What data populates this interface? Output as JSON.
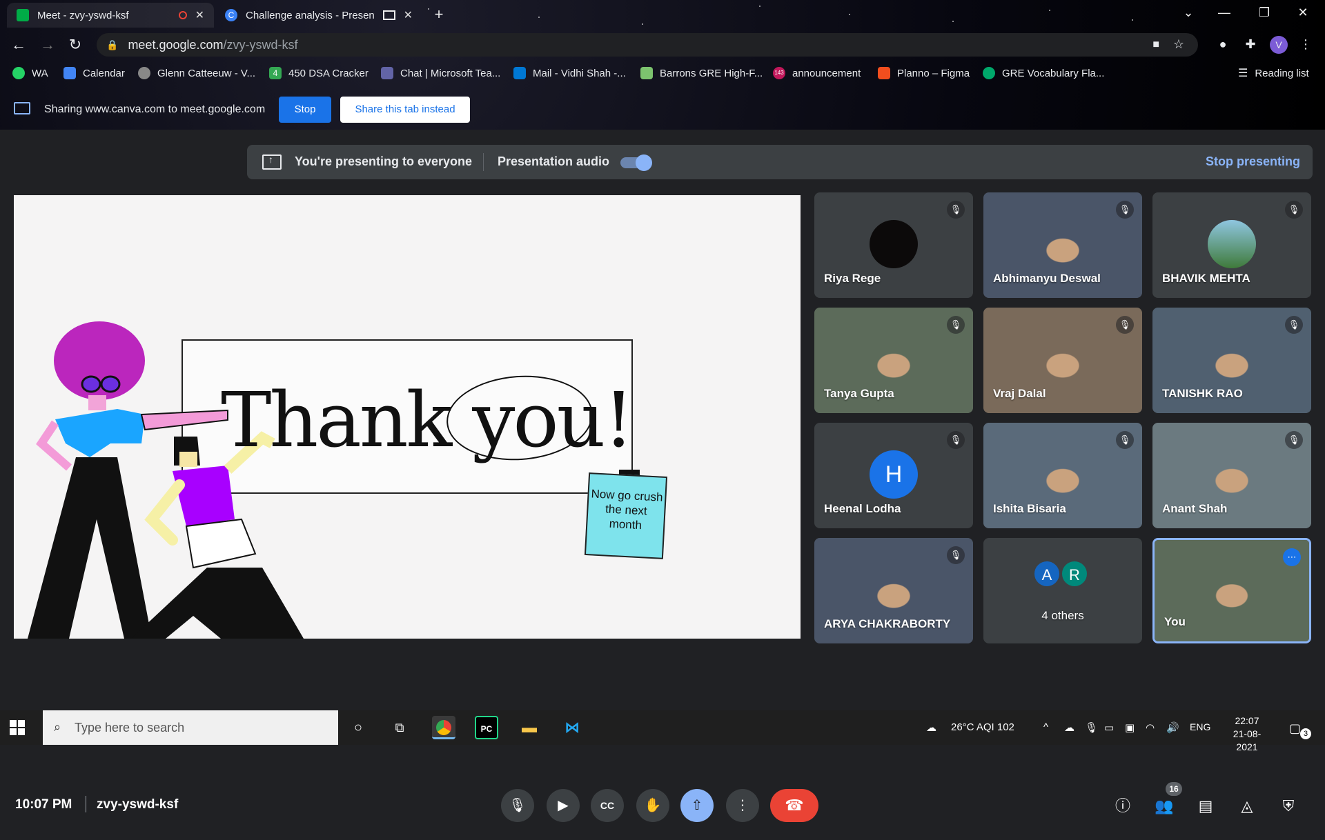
{
  "browser": {
    "tabs": [
      {
        "title": "Meet - zvy-yswd-ksf",
        "active": true,
        "recording": true
      },
      {
        "title": "Challenge analysis - Presenta",
        "active": false
      }
    ],
    "url_host": "meet.google.com",
    "url_path": "/zvy-yswd-ksf",
    "bookmarks": [
      "WA",
      "Calendar",
      "Glenn Catteeuw - V...",
      "450 DSA Cracker",
      "Chat | Microsoft Tea...",
      "Mail - Vidhi Shah -...",
      "Barrons GRE High-F...",
      "announcement",
      "Planno – Figma",
      "GRE Vocabulary Fla..."
    ],
    "reading_list": "Reading list",
    "bookmark_badges": {
      "dsa": "4",
      "announcement": "143"
    },
    "profile_initial": "V"
  },
  "share_bar": {
    "text": "Sharing www.canva.com to meet.google.com",
    "stop": "Stop",
    "share_tab": "Share this tab instead"
  },
  "present_bar": {
    "status": "You're presenting to everyone",
    "audio_label": "Presentation audio",
    "audio_on": true,
    "stop_label": "Stop presenting"
  },
  "slide": {
    "heading": "Thank you!",
    "note": "Now go crush the next month"
  },
  "participants": [
    {
      "name": "Riya Rege",
      "muted": true,
      "avatar": "dark-circle"
    },
    {
      "name": "Abhimanyu Deswal",
      "muted": true,
      "avatar": "video"
    },
    {
      "name": "BHAVIK MEHTA",
      "muted": true,
      "avatar": "photo"
    },
    {
      "name": "Tanya Gupta",
      "muted": true,
      "avatar": "video"
    },
    {
      "name": "Vraj Dalal",
      "muted": true,
      "avatar": "video"
    },
    {
      "name": "TANISHK RAO",
      "muted": true,
      "avatar": "video"
    },
    {
      "name": "Heenal Lodha",
      "muted": true,
      "avatar": "letter",
      "initial": "H"
    },
    {
      "name": "Ishita Bisaria",
      "muted": true,
      "avatar": "video"
    },
    {
      "name": "Anant Shah",
      "muted": true,
      "avatar": "video"
    },
    {
      "name": "ARYA CHAKRABORTY",
      "muted": true,
      "avatar": "video"
    },
    {
      "name": "4 others",
      "initials": [
        "A",
        "R"
      ]
    },
    {
      "name": "You",
      "self": true
    }
  ],
  "controls": {
    "time": "10:07 PM",
    "meeting_code": "zvy-yswd-ksf",
    "people_count": "16"
  },
  "taskbar": {
    "search_placeholder": "Type here to search",
    "weather": "26°C  AQI 102",
    "language": "ENG",
    "time": "22:07",
    "date": "21-08-2021",
    "notifications": "3"
  },
  "colors": {
    "meet_bg": "#202124",
    "tile_bg": "#3c4043",
    "accent_blue": "#8ab4f8",
    "hangup_red": "#ea4335",
    "share_blue": "#1a73e8"
  }
}
